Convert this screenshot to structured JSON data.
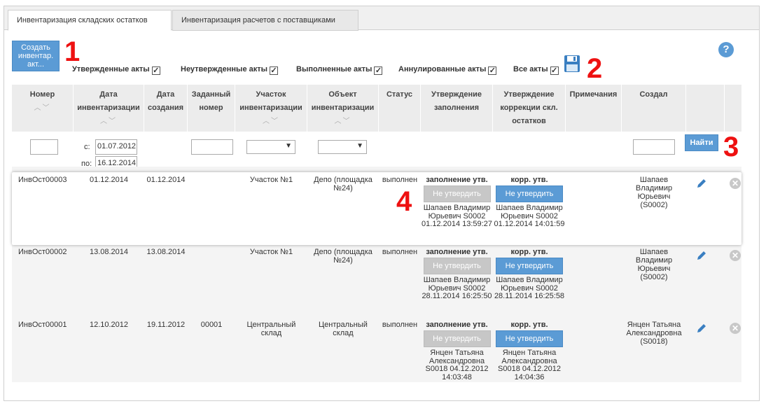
{
  "tabs": [
    {
      "label": "Инвентаризация складских остатков",
      "active": true
    },
    {
      "label": "Инвентаризация расчетов с поставщиками",
      "active": false
    }
  ],
  "toolbar": {
    "create_label": "Создать инвентар. акт...",
    "help_label": "?",
    "filters": [
      {
        "label": "Утвержденные акты",
        "checked": true
      },
      {
        "label": "Неутвержденные акты",
        "checked": true
      },
      {
        "label": "Выполненные акты",
        "checked": true
      },
      {
        "label": "Аннулированные акты",
        "checked": true
      },
      {
        "label": "Все акты",
        "checked": true
      }
    ]
  },
  "markers": {
    "m1": "1",
    "m2": "2",
    "m3": "3",
    "m4": "4"
  },
  "columns": [
    {
      "label": "Номер",
      "sortable": true
    },
    {
      "label": "Дата инвентаризации",
      "sortable": true
    },
    {
      "label": "Дата создания",
      "sortable": false
    },
    {
      "label": "Заданный номер",
      "sortable": false
    },
    {
      "label": "Участок инвентаризации",
      "sortable": true
    },
    {
      "label": "Объект инвентаризации",
      "sortable": true
    },
    {
      "label": "Статус",
      "sortable": false
    },
    {
      "label": "Утверждение заполнения",
      "sortable": false
    },
    {
      "label": "Утверждение коррекции скл. остатков",
      "sortable": false
    },
    {
      "label": "Примечания",
      "sortable": false
    },
    {
      "label": "Создал",
      "sortable": false
    }
  ],
  "sort_glyph": "︿﹀",
  "filter_row": {
    "from_label": "с:",
    "from_value": "01.07.2012",
    "to_label": "по:",
    "to_value": "16.12.2014",
    "find_label": "Найти"
  },
  "rows": [
    {
      "number": "ИнвОст00003",
      "inv_date": "01.12.2014",
      "created": "01.12.2014",
      "given_number": "",
      "section": "Участок №1",
      "object": "Депо (площадка №24)",
      "status": "выполнен",
      "fill_title": "заполнение утв.",
      "fill_button": "Не утвердить",
      "fill_info": "Шапаев Владимир Юрьевич S0002 01.12.2014 13:59:27",
      "corr_title": "корр. утв.",
      "corr_button": "Не утвердить",
      "corr_info": "Шапаев Владимир Юрьевич S0002 01.12.2014 14:01:59",
      "notes": "",
      "creator": "Шапаев Владимир Юрьевич (S0002)"
    },
    {
      "number": "ИнвОст00002",
      "inv_date": "13.08.2014",
      "created": "13.08.2014",
      "given_number": "",
      "section": "Участок №1",
      "object": "Депо (площадка №24)",
      "status": "выполнен",
      "fill_title": "заполнение утв.",
      "fill_button": "Не утвердить",
      "fill_info": "Шапаев Владимир Юрьевич S0002 28.11.2014 16:25:50",
      "corr_title": "корр. утв.",
      "corr_button": "Не утвердить",
      "corr_info": "Шапаев Владимир Юрьевич S0002 28.11.2014 16:25:58",
      "notes": "",
      "creator": "Шапаев Владимир Юрьевич (S0002)"
    },
    {
      "number": "ИнвОст00001",
      "inv_date": "12.10.2012",
      "created": "19.11.2012",
      "given_number": "00001",
      "section": "Центральный склад",
      "object": "Центральный склад",
      "status": "выполнен",
      "fill_title": "заполнение утв.",
      "fill_button": "Не утвердить",
      "fill_info": "Янцен Татьяна Александровна S0018 04.12.2012 14:03:48",
      "corr_title": "корр. утв.",
      "corr_button": "Не утвердить",
      "corr_info": "Янцен Татьяна Александровна S0018 04.12.2012 14:04:36",
      "notes": "",
      "creator": "Янцен Татьяна Александровна (S0018)"
    }
  ],
  "colors": {
    "accent": "#5b9bd5",
    "marker": "#ee1111",
    "disabled": "#c7c7c7"
  }
}
